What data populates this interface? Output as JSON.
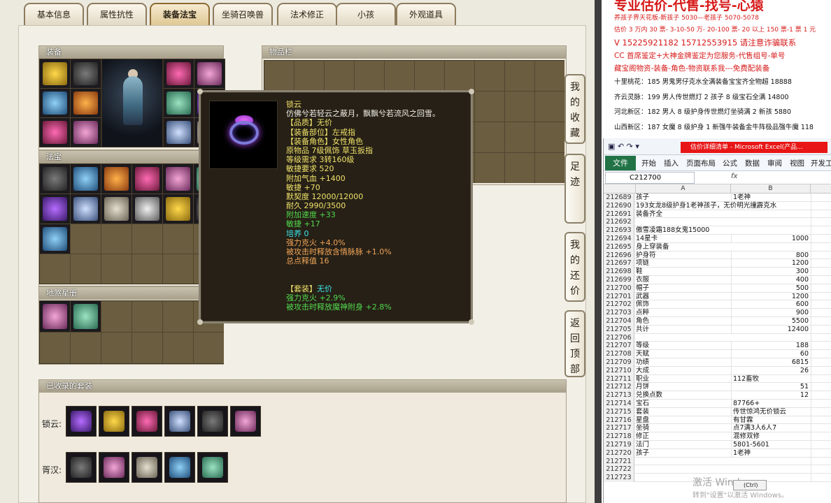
{
  "game": {
    "tabs": [
      "基本信息",
      "属性抗性",
      "装备法宝",
      "坐骑召唤兽",
      "法术修正",
      "小孩",
      "外观道具"
    ],
    "active_tab": 2,
    "sections": {
      "equipment": "装备",
      "inventory": "物品栏",
      "fabao": "法宝",
      "dizang": "地煞星册",
      "suits": "已收录的套装"
    },
    "side_buttons": [
      "我的收藏",
      "足迹",
      "我的还价",
      "返回顶部"
    ],
    "suit_rows": [
      {
        "label": "锁云:",
        "count": 6
      },
      {
        "label": "胥汉:",
        "count": 5
      }
    ],
    "tooltip": {
      "lines": [
        {
          "text": "锁云",
          "color": "yellow"
        },
        {
          "text": "仿佛兮若轻云之蔽月，飘飘兮若流风之回雪。",
          "color": "white"
        },
        {
          "text": "【品质】无价",
          "color": "yellow"
        },
        {
          "text": "【装备部位】左戒指",
          "color": "yellow"
        },
        {
          "text": "【装备角色】女性角色",
          "color": "yellow"
        },
        {
          "text": "原物品 7级佩饰 草玉扳指",
          "color": "yellow"
        },
        {
          "text": "等级需求 3转160级",
          "color": "yellow"
        },
        {
          "text": "敏捷要求 520",
          "color": "yellow"
        },
        {
          "text": "附加气血 +1400",
          "color": "yellow"
        },
        {
          "text": "敏捷 +70",
          "color": "yellow"
        },
        {
          "text": "默契度 12000/12000",
          "color": "yellow"
        },
        {
          "text": "耐久 2990/3500",
          "color": "yellow"
        },
        {
          "text": "附加速度 +33",
          "color": "green"
        },
        {
          "text": "敏捷 +17",
          "color": "green"
        },
        {
          "text": "培养 0",
          "color": "cyan"
        },
        {
          "text": "强力克火 +4.0%",
          "color": "orange"
        },
        {
          "text": "被攻击时释放含情脉脉 +1.0%",
          "color": "orange"
        },
        {
          "text": "总点释值  16",
          "color": "orange"
        },
        {
          "text": "",
          "color": "white"
        },
        {
          "text": "",
          "color": "white"
        },
        {
          "text": "【套装】无价",
          "color": "yellow",
          "cyan_tail": true
        },
        {
          "text": "强力克火 +2.9%",
          "color": "green"
        },
        {
          "text": "被攻击时释放魔神附身 +2.8%",
          "color": "green"
        }
      ]
    }
  },
  "ad": {
    "title": "专业估价-代售-找号-心猿",
    "line1": "养孩子界天花板-新孩子 5030—老孩子 5070-5078",
    "line2": "估价 3 万内 30 票- 3-10-50 万- 20-100 票- 20 以上 150 票-1 票 1 元",
    "phone": "V 15225921182     15712553915   请注意诈骗联系",
    "cc": "CC 首席鉴定+大神金牌鉴定为您服务-代售组号-单号",
    "treasure": "藏宝阁物资-装备-角色-物资联系我---免费配装备",
    "listings": [
      "十里桃花：185 男鬼男仔克水全满装备宝宝齐全物超 18888",
      "齐云灵脉：199 男人传世燃灯 2 孩子 8 级宝石全满 14800",
      "河北新区：182 男人 8 级护身传世燃灯坐骑满 2 新孩 5880",
      "山西新区：187 女魔 8 级护身 1 新强牛装备金牛阵极品强牛魔 118"
    ]
  },
  "excel": {
    "title": "估价详细清单 - Microsoft Excel(产品...",
    "file_tab": "文件",
    "ribbon_tabs": [
      "开始",
      "插入",
      "页面布局",
      "公式",
      "数据",
      "审阅",
      "视图",
      "开发工"
    ],
    "name_box": "C212700",
    "fx": "fx",
    "col_a": "A",
    "col_b": "B",
    "paste_label": "(Ctrl)",
    "rows": [
      {
        "n": "212689",
        "a": "孩子",
        "b": "1老神"
      },
      {
        "n": "212690",
        "a": "193女龙8级护身1老神孩子，无价明光撞霹克水",
        "b": ""
      },
      {
        "n": "212691",
        "a": "装备齐全",
        "b": ""
      },
      {
        "n": "212692",
        "a": "",
        "b": ""
      },
      {
        "n": "212693",
        "a": "傲雪凌霜188女鬼15000",
        "b": ""
      },
      {
        "n": "212694",
        "a": "14星卡",
        "b": "1000",
        "num": true
      },
      {
        "n": "212695",
        "a": "身上穿装备",
        "b": ""
      },
      {
        "n": "212696",
        "a": "护身符",
        "b": "800",
        "num": true
      },
      {
        "n": "212697",
        "a": "项链",
        "b": "1200",
        "num": true
      },
      {
        "n": "212698",
        "a": "鞋",
        "b": "300",
        "num": true
      },
      {
        "n": "212699",
        "a": "衣服",
        "b": "400",
        "num": true
      },
      {
        "n": "212700",
        "a": "帽子",
        "b": "500",
        "num": true
      },
      {
        "n": "212701",
        "a": "武器",
        "b": "1200",
        "num": true
      },
      {
        "n": "212702",
        "a": "佩饰",
        "b": "600",
        "num": true
      },
      {
        "n": "212703",
        "a": "点粹",
        "b": "900",
        "num": true
      },
      {
        "n": "212704",
        "a": "角色",
        "b": "5500",
        "num": true
      },
      {
        "n": "212705",
        "a": "共计",
        "b": "12400",
        "num": true
      },
      {
        "n": "212706",
        "a": "",
        "b": ""
      },
      {
        "n": "212707",
        "a": "等级",
        "b": "188",
        "num": true
      },
      {
        "n": "212708",
        "a": "天赋",
        "b": "60",
        "num": true
      },
      {
        "n": "212709",
        "a": "功绩",
        "b": "6815",
        "num": true
      },
      {
        "n": "212710",
        "a": "大成",
        "b": "26",
        "num": true
      },
      {
        "n": "212711",
        "a": "职业",
        "b": "112畜牧"
      },
      {
        "n": "212712",
        "a": "月饼",
        "b": "51",
        "num": true
      },
      {
        "n": "212713",
        "a": "兑换点数",
        "b": "12",
        "num": true
      },
      {
        "n": "212714",
        "a": "宝石",
        "b": "87766+"
      },
      {
        "n": "212715",
        "a": "套装",
        "b": "传世惊鸿无价锁云"
      },
      {
        "n": "212716",
        "a": "星盘",
        "b": "  有甘霖"
      },
      {
        "n": "212717",
        "a": "坐骑",
        "b": "点7满3人6人7"
      },
      {
        "n": "212718",
        "a": "修正",
        "b": "混修双修"
      },
      {
        "n": "212719",
        "a": "法门",
        "b": "5801-5601"
      },
      {
        "n": "212720",
        "a": "孩子",
        "b": "1老神"
      },
      {
        "n": "212721",
        "a": "",
        "b": ""
      },
      {
        "n": "212722",
        "a": "",
        "b": ""
      },
      {
        "n": "212723",
        "a": "",
        "b": ""
      }
    ]
  },
  "watermark": {
    "line1": "激活 Windows",
    "line2": "转到\"设置\"以激活 Windows。"
  },
  "colors": {
    "yellow": "#f0e26a",
    "white": "#f1efe8",
    "green": "#52d84d",
    "cyan": "#3ee6e8",
    "orange": "#f0a358",
    "ad_red": "#d71a1a",
    "excel_green": "#217346"
  }
}
